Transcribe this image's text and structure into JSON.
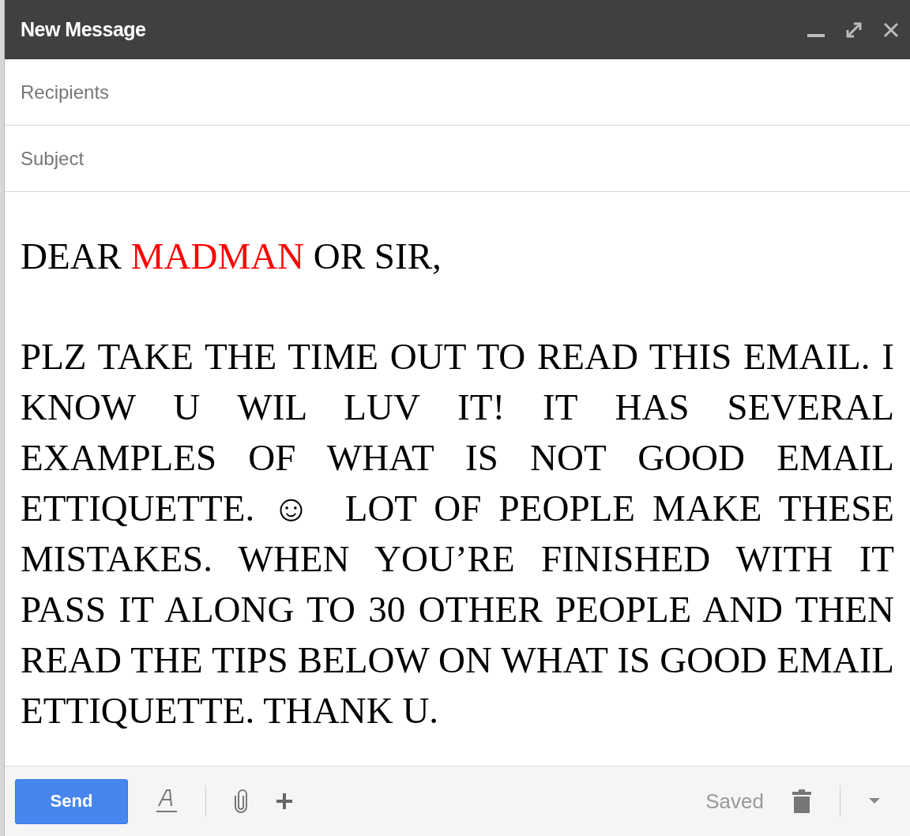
{
  "window": {
    "title": "New Message"
  },
  "recipients": {
    "placeholder": "Recipients"
  },
  "subject": {
    "placeholder": "Subject"
  },
  "body": {
    "greeting": [
      {
        "text": "DEAR ",
        "highlighted": false
      },
      {
        "text": "MADMAN",
        "highlighted": true
      },
      {
        "text": " OR SIR,",
        "highlighted": false
      }
    ],
    "paragraph": "PLZ TAKE THE TIME OUT TO READ THIS EMAIL. I KNOW U WIL LUV IT! IT HAS SEVERAL EXAMPLES OF WHAT IS NOT GOOD EMAIL ETTIQUETTE. ☺  LOT OF PEOPLE MAKE THESE MISTAKES. WHEN YOU’RE FINISHED WITH IT PASS IT ALONG TO 30 OTHER PEOPLE AND THEN READ THE TIPS BELOW ON WHAT IS GOOD EMAIL ETTIQUETTE. THANK U."
  },
  "toolbar": {
    "send": "Send",
    "status": "Saved"
  }
}
